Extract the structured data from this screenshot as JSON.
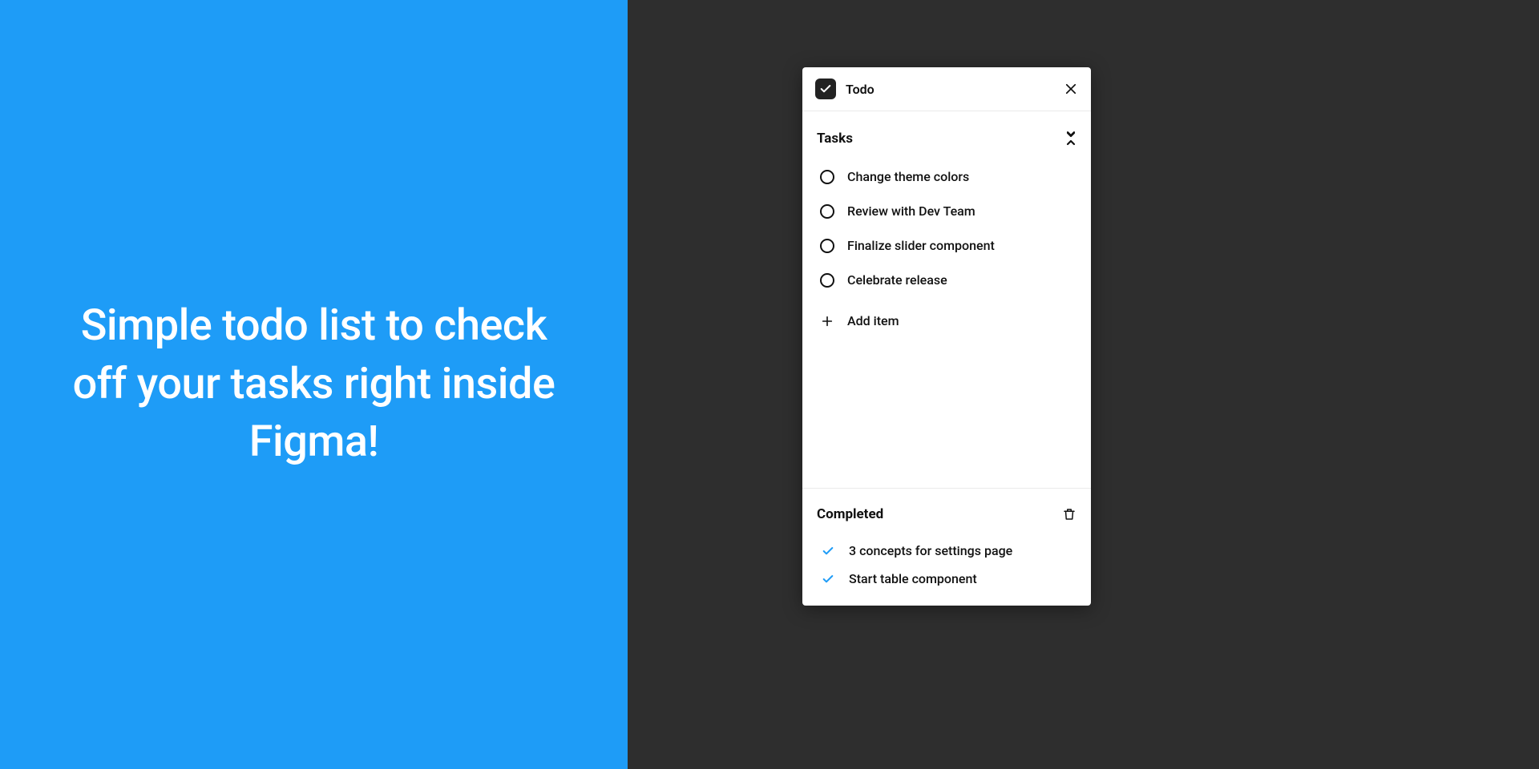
{
  "left": {
    "tagline": "Simple todo list to check off your tasks right inside Figma!"
  },
  "panel": {
    "title": "Todo",
    "tasks_section": {
      "title": "Tasks",
      "items": [
        {
          "label": "Change theme colors"
        },
        {
          "label": "Review with Dev Team"
        },
        {
          "label": "Finalize slider component"
        },
        {
          "label": "Celebrate release"
        }
      ],
      "add_label": "Add item"
    },
    "completed_section": {
      "title": "Completed",
      "items": [
        {
          "label": "3 concepts for settings page"
        },
        {
          "label": "Start table component"
        }
      ]
    }
  },
  "colors": {
    "left_bg": "#1e9cf7",
    "right_bg": "#2e2e2e",
    "accent": "#1e9cf7"
  }
}
